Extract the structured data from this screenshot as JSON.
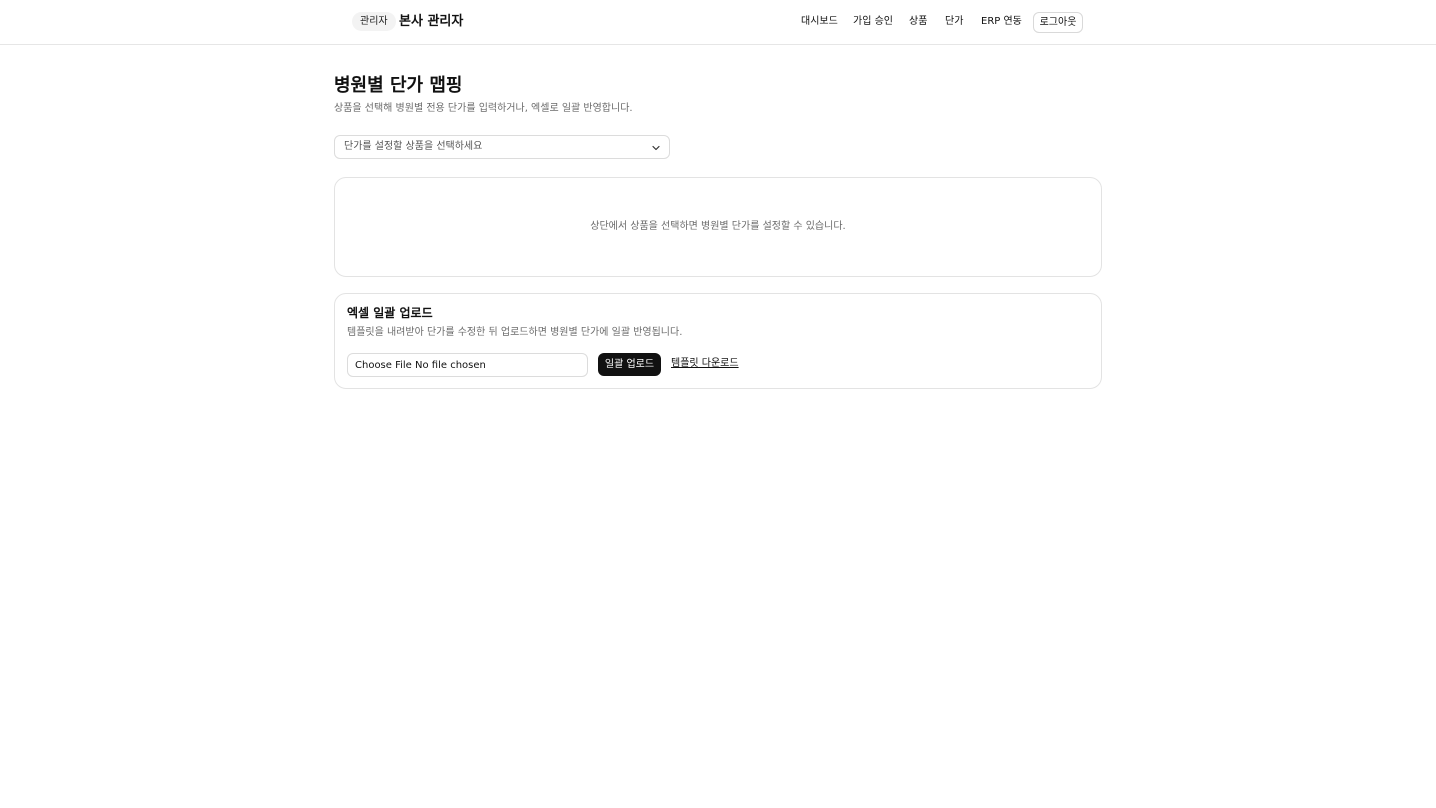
{
  "header": {
    "role_badge": "관리자",
    "brand": "본사 관리자",
    "nav": [
      "대시보드",
      "가입 승인",
      "상품",
      "단가",
      "ERP 연동"
    ],
    "logout_label": "로그아웃"
  },
  "main": {
    "title": "병원별 단가 맵핑",
    "description": "상품을 선택해 병원별 전용 단가를 입력하거나, 엑셀로 일괄 반영합니다.",
    "product_select": {
      "placeholder": "단가를 설정할 상품을 선택하세요",
      "icon": "chevron-down-icon"
    },
    "empty_state": "상단에서 상품을 선택하면 병원별 단가를 설정할 수 있습니다.",
    "bulk_upload": {
      "title": "엑셀 일괄 업로드",
      "description": "템플릿을 내려받아 단가를 수정한 뒤 업로드하면 병원별 단가에 일괄 반영됩니다.",
      "file_input_text": "Choose File No file chosen",
      "upload_button": "일괄 업로드",
      "template_link": "템플릿 다운로드"
    }
  },
  "colors": {
    "primary_button": "#111111",
    "border": "#e3e3e3",
    "muted_text": "#6b6b6b"
  }
}
